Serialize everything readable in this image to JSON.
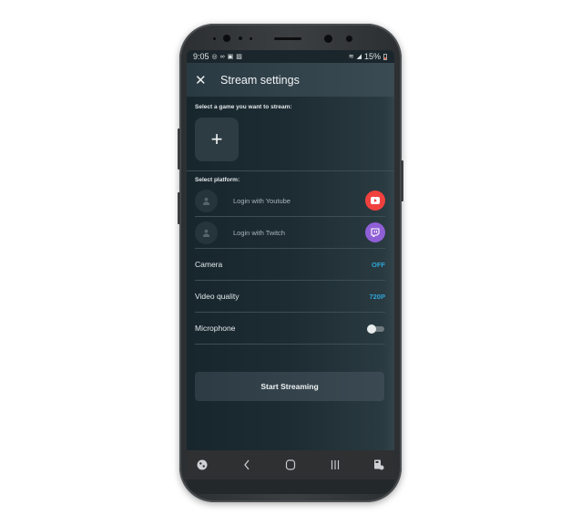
{
  "status_bar": {
    "time": "9:05",
    "left_icons": [
      "whatsapp-icon",
      "voicemail-icon",
      "notification-icon",
      "gallery-icon"
    ],
    "battery": "15%",
    "right_icons": [
      "wifi-icon",
      "signal-icon",
      "battery-icon"
    ]
  },
  "app_bar": {
    "close_icon": "close-icon",
    "title": "Stream settings"
  },
  "game_section": {
    "label": "Select a game you want to stream:",
    "add_icon": "+"
  },
  "platform_section": {
    "label": "Select platform:",
    "platforms": [
      {
        "label": "Login with Youtube",
        "icon": "youtube-icon",
        "color": "#f0413f"
      },
      {
        "label": "Login with Twitch",
        "icon": "twitch-icon",
        "color": "#8f5fd6"
      }
    ]
  },
  "settings": {
    "camera": {
      "label": "Camera",
      "value": "OFF"
    },
    "video_quality": {
      "label": "Video quality",
      "value": "720P"
    },
    "microphone": {
      "label": "Microphone",
      "enabled": false
    }
  },
  "start_button": {
    "label": "Start Streaming"
  },
  "colors": {
    "accent": "#2fa6d9",
    "youtube": "#f0413f",
    "twitch": "#8f5fd6"
  },
  "nav_bar": {
    "items": [
      "accessibility-icon",
      "back-icon",
      "home-icon",
      "recents-icon",
      "screen-lock-icon"
    ]
  }
}
